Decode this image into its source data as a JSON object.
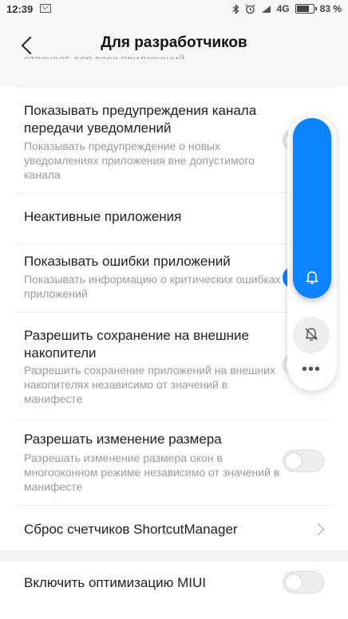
{
  "status_bar": {
    "time": "12:39",
    "network": "4G",
    "battery_percent": "83 %",
    "battery_level": 0.83,
    "icons": [
      "mail-icon",
      "bluetooth-icon",
      "alarm-icon",
      "signal-icon",
      "battery-icon"
    ]
  },
  "header": {
    "title": "Для разработчиков",
    "back_icon": "chevron-left-icon"
  },
  "partial_text": "отвечает для всех приложений",
  "settings": {
    "items": [
      {
        "title": "Показывать предупреждения канала передачи уведомлений",
        "description": "Показывать предупреждение о новых уведомлениях приложения вне допустимого канала",
        "toggle": false
      },
      {
        "title": "Неактивные приложения"
      },
      {
        "title": "Показывать ошибки приложений",
        "description": "Показывать информацию о критических ошибках приложений",
        "toggle": true
      },
      {
        "title": "Разрешить сохранение на внешние накопители",
        "description": "Разрешить сохранение приложений на внешних накопителях независимо от значений в манифесте",
        "toggle": false
      },
      {
        "title": "Разрешать изменение размера",
        "description": "Разрешать изменение размера окон в многооконном режиме независимо от значений в манифесте",
        "toggle": false
      },
      {
        "title": "Сброс счетчиков ShortcutManager",
        "chevron": true
      }
    ],
    "miui": {
      "title": "Включить оптимизацию MIUI",
      "toggle": false
    }
  },
  "volume_panel": {
    "level": 1.0,
    "accent_color": "#0d84ff",
    "icons": [
      "bell-icon",
      "bell-off-icon",
      "more-icon"
    ],
    "more_label": "•••"
  },
  "colors": {
    "accent": "#0d84ff",
    "background": "#f7f7f7",
    "card": "#ffffff",
    "secondary_text": "#9b9b9b"
  }
}
